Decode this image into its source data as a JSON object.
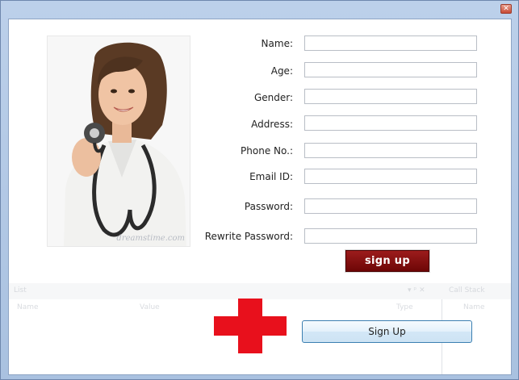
{
  "window": {
    "close_glyph": "✕"
  },
  "form": {
    "fields": [
      {
        "label": "Name:",
        "value": ""
      },
      {
        "label": "Age:",
        "value": ""
      },
      {
        "label": "Gender:",
        "value": ""
      },
      {
        "label": "Address:",
        "value": ""
      },
      {
        "label": "Phone No.:",
        "value": ""
      },
      {
        "label": "Email ID:",
        "value": ""
      },
      {
        "label": "Password:",
        "value": ""
      },
      {
        "label": "Rewrite Password:",
        "value": ""
      }
    ],
    "image_signup_label": "sign up",
    "signup_button_label": "Sign Up"
  },
  "photo": {
    "watermark": "dreamstime.com"
  },
  "background_ghost": {
    "left_label": "List",
    "right_label": "Call Stack",
    "controls": "▾ ᵖ ✕",
    "col_name": "Name",
    "col_value": "Value",
    "col_type": "Type"
  },
  "colors": {
    "frame": "#a9c1e0",
    "dark_red_button": "#7a0c0c",
    "red_cross": "#e8101c",
    "blue_button_border": "#3c7fb1"
  },
  "icons": {
    "close": "close-icon",
    "cross": "red-cross-icon"
  }
}
